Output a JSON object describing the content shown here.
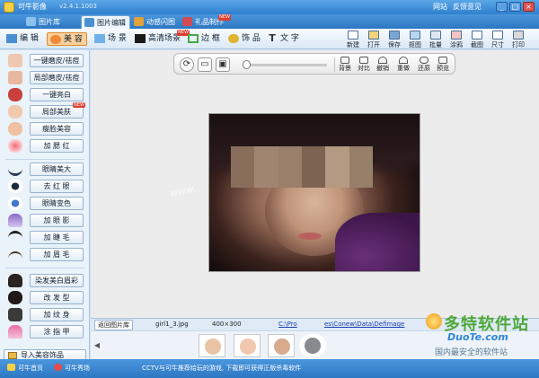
{
  "titlebar": {
    "title": "可牛影像",
    "version": "v2.4.1.1003",
    "links": [
      "网站",
      "反馈意见"
    ],
    "min": "_",
    "max": "□",
    "close": "×"
  },
  "tabs": [
    {
      "label": "图片库",
      "icon": "picture-library-icon",
      "color": "#8cc1ee",
      "badge": ""
    },
    {
      "label": "图片编辑",
      "icon": "image-edit-icon",
      "color": "#4a8fd4",
      "badge": ""
    },
    {
      "label": "动感闪图",
      "icon": "animated-gif-icon",
      "color": "#e3a23a",
      "badge": ""
    },
    {
      "label": "礼品制作",
      "icon": "gift-icon",
      "color": "#d34c54",
      "badge": "NEW"
    }
  ],
  "tools": [
    {
      "label": "编 辑",
      "icon": "edit-icon",
      "color": "#4a8fd4",
      "badge": ""
    },
    {
      "label": "美 容",
      "icon": "beauty-icon",
      "color": "#f08a3a",
      "badge": ""
    },
    {
      "label": "场 景",
      "icon": "scene-icon",
      "color": "#6fb1e8",
      "badge": ""
    },
    {
      "label": "高清场景",
      "icon": "hd-scene-icon",
      "color": "#1a1a1a",
      "badge": "NEW"
    },
    {
      "label": "边 框",
      "icon": "frame-icon",
      "color": "#46a846",
      "badge": ""
    },
    {
      "label": "饰 品",
      "icon": "accessory-icon",
      "color": "#e0b431",
      "badge": ""
    },
    {
      "label": "文 字",
      "icon": "text-icon",
      "color": "#333333",
      "badge": ""
    }
  ],
  "right_tools": [
    "新建",
    "打开",
    "保存",
    "抠图",
    "批量",
    "涂鸦",
    "截图",
    "尺寸",
    "打印"
  ],
  "left_panel": {
    "groups": [
      [
        {
          "label": "一键磨皮/祛痘",
          "icon": "skin-smooth-icon",
          "badge": ""
        },
        {
          "label": "局部磨皮/祛痘",
          "icon": "partial-smooth-icon",
          "badge": ""
        },
        {
          "label": "一键亮白",
          "icon": "whitening-icon",
          "badge": ""
        },
        {
          "label": "局部美肤",
          "icon": "partial-skin-icon",
          "badge": "NEW"
        },
        {
          "label": "瘦脸美容",
          "icon": "face-slim-icon",
          "badge": ""
        },
        {
          "label": "加 腮 红",
          "icon": "blush-icon",
          "badge": ""
        }
      ],
      [
        {
          "label": "眼睛美大",
          "icon": "eye-enlarge-icon",
          "badge": ""
        },
        {
          "label": "去 红 眼",
          "icon": "red-eye-icon",
          "badge": ""
        },
        {
          "label": "眼睛变色",
          "icon": "eye-color-icon",
          "badge": ""
        },
        {
          "label": "加 眼 影",
          "icon": "eye-shadow-icon",
          "badge": ""
        },
        {
          "label": "加 睫 毛",
          "icon": "eyelash-icon",
          "badge": ""
        },
        {
          "label": "加 眉 毛",
          "icon": "eyebrow-icon",
          "badge": ""
        }
      ],
      [
        {
          "label": "染发美白眉彩",
          "icon": "hair-dye-icon",
          "badge": ""
        },
        {
          "label": "改 发 型",
          "icon": "hairstyle-icon",
          "badge": ""
        },
        {
          "label": "加 纹 身",
          "icon": "tattoo-icon",
          "badge": ""
        },
        {
          "label": "涂 指 甲",
          "icon": "nail-polish-icon",
          "badge": ""
        }
      ]
    ],
    "import_label": "导入美容饰品"
  },
  "control_bar": {
    "buttons": [
      "背景",
      "对比",
      "撤销",
      "重做",
      "还原",
      "预览"
    ],
    "zoom_level": 0
  },
  "photo": {
    "watermark": "www.",
    "mosaic_colors": [
      "#8a6e5c",
      "#a08670",
      "#9a7f6a",
      "#7c6352",
      "#b49a82",
      "#968069"
    ]
  },
  "infobar": {
    "library_button": "返回图片库",
    "filename": "girl1_3.jpg",
    "dimensions": "400×300",
    "path_start": "C:\\Pro",
    "path_end": "es\\Conew\\Data\\Defimage"
  },
  "thumbnails": [
    "#e8c3a6",
    "#f2c7b0",
    "#d8ab8e",
    "#888a8e"
  ],
  "statusbar": {
    "home": "可牛首页",
    "show": "可牛秀场",
    "message": "CCTV与可牛推荐给玩的游戏, 下载即可获得正版杀毒软件"
  },
  "brand": {
    "name": "多特软件站",
    "url": "DuoTe.com",
    "tagline": "国内最安全的软件站"
  }
}
